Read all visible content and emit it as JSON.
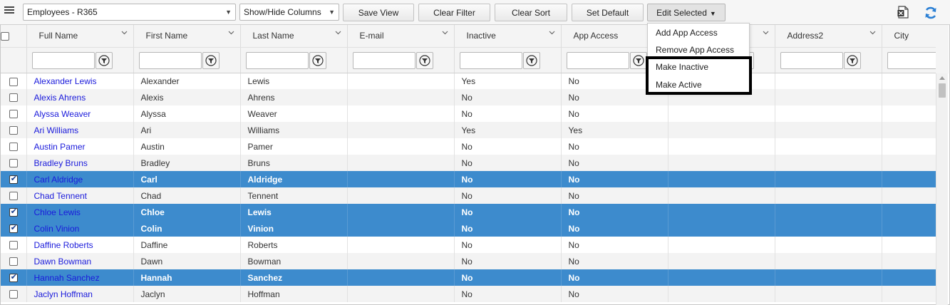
{
  "toolbar": {
    "view_select": "Employees - R365",
    "show_hide": "Show/Hide Columns",
    "save_view": "Save View",
    "clear_filter": "Clear Filter",
    "clear_sort": "Clear Sort",
    "set_default": "Set Default",
    "edit_selected": "Edit Selected"
  },
  "edit_menu": {
    "items": [
      "Add App Access",
      "Remove App Access",
      "Make Inactive",
      "Make Active"
    ]
  },
  "columns": [
    "Full Name",
    "First Name",
    "Last Name",
    "E-mail",
    "Inactive",
    "App Access",
    "",
    "Address2",
    "City"
  ],
  "rows": [
    {
      "full_name": "Alexander Lewis",
      "first": "Alexander",
      "last": "Lewis",
      "email": "",
      "inactive": "Yes",
      "app_access": "No",
      "selected": false
    },
    {
      "full_name": "Alexis Ahrens",
      "first": "Alexis",
      "last": "Ahrens",
      "email": "",
      "inactive": "No",
      "app_access": "No",
      "selected": false
    },
    {
      "full_name": "Alyssa Weaver",
      "first": "Alyssa",
      "last": "Weaver",
      "email": "",
      "inactive": "No",
      "app_access": "No",
      "selected": false
    },
    {
      "full_name": "Ari Williams",
      "first": "Ari",
      "last": "Williams",
      "email": "",
      "inactive": "Yes",
      "app_access": "Yes",
      "selected": false
    },
    {
      "full_name": "Austin Pamer",
      "first": "Austin",
      "last": "Pamer",
      "email": "",
      "inactive": "No",
      "app_access": "No",
      "selected": false
    },
    {
      "full_name": "Bradley Bruns",
      "first": "Bradley",
      "last": "Bruns",
      "email": "",
      "inactive": "No",
      "app_access": "No",
      "selected": false
    },
    {
      "full_name": "Carl Aldridge",
      "first": "Carl",
      "last": "Aldridge",
      "email": "",
      "inactive": "No",
      "app_access": "No",
      "selected": true
    },
    {
      "full_name": "Chad Tennent",
      "first": "Chad",
      "last": "Tennent",
      "email": "",
      "inactive": "No",
      "app_access": "No",
      "selected": false
    },
    {
      "full_name": "Chloe Lewis",
      "first": "Chloe",
      "last": "Lewis",
      "email": "",
      "inactive": "No",
      "app_access": "No",
      "selected": true
    },
    {
      "full_name": "Colin Vinion",
      "first": "Colin",
      "last": "Vinion",
      "email": "",
      "inactive": "No",
      "app_access": "No",
      "selected": true
    },
    {
      "full_name": "Daffine Roberts",
      "first": "Daffine",
      "last": "Roberts",
      "email": "",
      "inactive": "No",
      "app_access": "No",
      "selected": false
    },
    {
      "full_name": "Dawn Bowman",
      "first": "Dawn",
      "last": "Bowman",
      "email": "",
      "inactive": "No",
      "app_access": "No",
      "selected": false
    },
    {
      "full_name": "Hannah Sanchez",
      "first": "Hannah",
      "last": "Sanchez",
      "email": "",
      "inactive": "No",
      "app_access": "No",
      "selected": true
    },
    {
      "full_name": "Jaclyn Hoffman",
      "first": "Jaclyn",
      "last": "Hoffman",
      "email": "",
      "inactive": "No",
      "app_access": "No",
      "selected": false
    }
  ],
  "colors": {
    "selected_row": "#3d8bcd",
    "link": "#1a1adb",
    "highlight_border": "#000000"
  },
  "icons": [
    "menu-icon",
    "chevron-down-icon",
    "filter-icon",
    "excel-export-icon",
    "refresh-icon",
    "checkbox-icon"
  ]
}
